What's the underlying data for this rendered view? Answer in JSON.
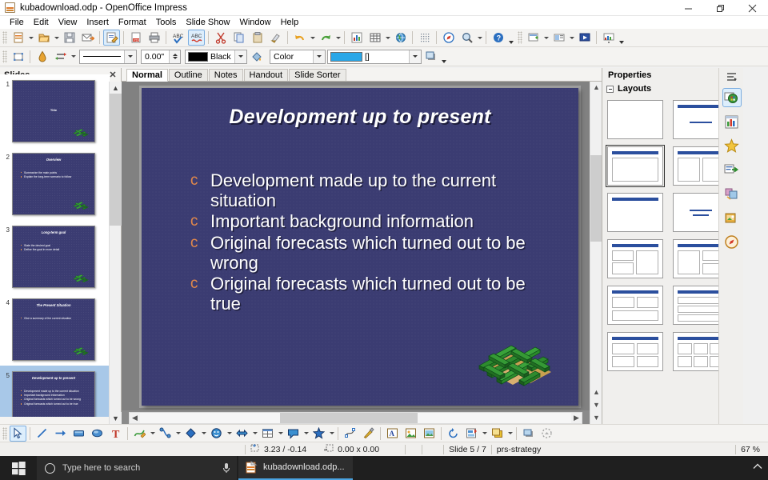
{
  "window": {
    "title": "kubadownload.odp - OpenOffice Impress",
    "icon": "impress-document-icon",
    "controls": {
      "minimize": "–",
      "restore": "❐",
      "close": "✕"
    }
  },
  "menubar": {
    "items": [
      "File",
      "Edit",
      "View",
      "Insert",
      "Format",
      "Tools",
      "Slide Show",
      "Window",
      "Help"
    ]
  },
  "toolbar_standard": {
    "items": [
      {
        "name": "new-document",
        "glyph": "new",
        "dropdown": true
      },
      {
        "name": "open-document",
        "glyph": "open",
        "dropdown": true
      },
      {
        "name": "save-document",
        "glyph": "save"
      },
      {
        "name": "email-document",
        "glyph": "email"
      },
      {
        "name": "edit-file",
        "glyph": "editfile",
        "active": true
      },
      {
        "name": "export-pdf",
        "glyph": "pdf"
      },
      {
        "name": "print-file",
        "glyph": "print"
      },
      {
        "name": "spelling",
        "glyph": "abc-check"
      },
      {
        "name": "autospellcheck",
        "glyph": "abc-red",
        "active": true
      },
      {
        "name": "cut",
        "glyph": "cut"
      },
      {
        "name": "copy",
        "glyph": "copy"
      },
      {
        "name": "paste",
        "glyph": "paste"
      },
      {
        "name": "clone-formatting",
        "glyph": "brush"
      },
      {
        "name": "undo",
        "glyph": "undo",
        "dropdown": true
      },
      {
        "name": "redo",
        "glyph": "redo",
        "dropdown": true
      },
      {
        "name": "insert-chart",
        "glyph": "chart"
      },
      {
        "name": "insert-table",
        "glyph": "table",
        "dropdown": true
      },
      {
        "name": "hyperlink",
        "glyph": "globe"
      },
      {
        "name": "display-grid",
        "glyph": "grid"
      },
      {
        "name": "navigator",
        "glyph": "compass"
      },
      {
        "name": "zoom",
        "glyph": "zoom",
        "dropdown": true
      },
      {
        "name": "help",
        "glyph": "help"
      },
      {
        "name": "master-slide",
        "glyph": "masterpage",
        "dropdown": true
      },
      {
        "name": "display-views",
        "glyph": "displayview",
        "dropdown": true
      },
      {
        "name": "start-slideshow",
        "glyph": "slideshow"
      },
      {
        "name": "slide-show-settings",
        "glyph": "showsettings"
      }
    ]
  },
  "toolbar_line_fill": {
    "line_style_value": "—————",
    "line_width_value": "0.00\"",
    "line_color_name": "Black",
    "line_color_hex": "#000000",
    "fill_style_value": "Color",
    "fill_color_name": "[]",
    "fill_color_hex": "#29a7e8",
    "buttons": [
      {
        "name": "position-and-size",
        "glyph": "possize"
      },
      {
        "name": "line-color",
        "glyph": "linecolor"
      },
      {
        "name": "arrow-style",
        "glyph": "arrowstyle",
        "dropdown": true
      },
      {
        "name": "area-style",
        "glyph": "bucket"
      },
      {
        "name": "shadow",
        "glyph": "shadow"
      }
    ]
  },
  "slides_panel": {
    "title": "Slides",
    "close_icon": "✕",
    "thumbnails": [
      {
        "number": "1",
        "title": "Title",
        "title_italic": false,
        "bullets": []
      },
      {
        "number": "2",
        "title": "Overview",
        "title_italic": true,
        "bullets": [
          "Summarize the main points",
          "Explain the long-term scenario to follow"
        ]
      },
      {
        "number": "3",
        "title": "Long-term goal",
        "title_italic": true,
        "bullets": [
          "State the desired goal",
          "Define the goal in more detail"
        ]
      },
      {
        "number": "4",
        "title": "The Present Situation",
        "title_italic": true,
        "bullets": [
          "Give a summary of the current situation"
        ]
      },
      {
        "number": "5",
        "title": "Development up to present",
        "title_italic": true,
        "selected": true,
        "bullets": [
          "Development made up to the current situation",
          "Important background information",
          "Original forecasts which turned out to be wrong",
          "Original forecasts which turned out to be true"
        ]
      }
    ]
  },
  "view_tabs": {
    "items": [
      {
        "label": "Normal",
        "active": true
      },
      {
        "label": "Outline",
        "active": false
      },
      {
        "label": "Notes",
        "active": false
      },
      {
        "label": "Handout",
        "active": false
      },
      {
        "label": "Slide Sorter",
        "active": false
      }
    ]
  },
  "slide": {
    "title": "Development up to present",
    "bullet_marker": "ɔ",
    "bullet_color": "#e2884a",
    "background_color": "#3b3c72",
    "text_color": "#ffffff",
    "bullets": [
      "Development made up to the current situation",
      "Important background information",
      "Original forecasts which turned out to be wrong",
      "Original forecasts which turned out to be true"
    ],
    "decoration": "isometric-maze-graphic"
  },
  "properties_panel": {
    "title": "Properties",
    "close_icon": "✕",
    "more_options_icon": "panel-menu-icon",
    "section_title": "Layouts",
    "layouts": [
      {
        "name": "blank-slide",
        "type": "blank",
        "selected": false
      },
      {
        "name": "title-content",
        "type": "title-subtitle",
        "selected": false
      },
      {
        "name": "title-only-content",
        "type": "title-body",
        "selected": true
      },
      {
        "name": "title-two-content",
        "type": "title-two-box",
        "selected": false
      },
      {
        "name": "title-only",
        "type": "title-empty",
        "selected": false
      },
      {
        "name": "centered-text",
        "type": "centered-lines",
        "selected": false
      },
      {
        "name": "two-content-left-split",
        "type": "title-left-split",
        "selected": false
      },
      {
        "name": "two-content-right-split",
        "type": "title-right-split",
        "selected": false
      },
      {
        "name": "two-top-one-bottom",
        "type": "title-two-top-one-bottom",
        "selected": false
      },
      {
        "name": "three-rows",
        "type": "title-three-rows",
        "selected": false
      },
      {
        "name": "four-content",
        "type": "title-four-box",
        "selected": false
      },
      {
        "name": "six-content",
        "type": "title-six-box",
        "selected": false
      }
    ],
    "tabs": [
      {
        "name": "master-pages-tab",
        "icon": "master-pages-icon",
        "selected": true
      },
      {
        "name": "character-styles-tab",
        "icon": "styles-icon",
        "selected": false
      },
      {
        "name": "gallery-tab",
        "icon": "gallery-star-icon",
        "selected": false
      },
      {
        "name": "animation-tab",
        "icon": "custom-animation-icon",
        "selected": false
      },
      {
        "name": "slide-transition-tab",
        "icon": "slide-transition-icon",
        "selected": false
      },
      {
        "name": "shapes-tab",
        "icon": "shapes-icon",
        "selected": false
      },
      {
        "name": "navigator-tab",
        "icon": "navigator-compass-icon",
        "selected": false
      }
    ]
  },
  "drawing_toolbar": {
    "items": [
      {
        "name": "select-tool",
        "glyph": "arrow",
        "active": true
      },
      {
        "name": "line-tool",
        "glyph": "line"
      },
      {
        "name": "line-ends-with-arrow",
        "glyph": "arrowline"
      },
      {
        "name": "rectangle-tool",
        "glyph": "rect"
      },
      {
        "name": "ellipse-tool",
        "glyph": "ellipse"
      },
      {
        "name": "text-tool",
        "glyph": "text"
      },
      {
        "name": "curve-tool",
        "glyph": "curve",
        "dropdown": true
      },
      {
        "name": "connector-tool",
        "glyph": "connector",
        "dropdown": true
      },
      {
        "name": "basic-shapes",
        "glyph": "diamond",
        "dropdown": true
      },
      {
        "name": "symbol-shapes",
        "glyph": "smiley",
        "dropdown": true
      },
      {
        "name": "block-arrows",
        "glyph": "blockarrow",
        "dropdown": true
      },
      {
        "name": "flowchart-shapes",
        "glyph": "flowchart",
        "dropdown": true
      },
      {
        "name": "callout-shapes",
        "glyph": "callout",
        "dropdown": true
      },
      {
        "name": "stars-shapes",
        "glyph": "star",
        "dropdown": true
      },
      {
        "name": "points-tool",
        "glyph": "points"
      },
      {
        "name": "glue-points",
        "glyph": "gluepoint"
      },
      {
        "name": "fontwork-gallery",
        "glyph": "fontwork"
      },
      {
        "name": "insert-image",
        "glyph": "image"
      },
      {
        "name": "insert-chart-draw",
        "glyph": "drawchart"
      },
      {
        "name": "rotate-tool",
        "glyph": "rotate"
      },
      {
        "name": "alignment",
        "glyph": "align",
        "dropdown": true
      },
      {
        "name": "arrange",
        "glyph": "arrange",
        "dropdown": true
      },
      {
        "name": "shadow-draw",
        "glyph": "shadowdraw"
      },
      {
        "name": "filter-draw",
        "glyph": "filter"
      }
    ]
  },
  "statusbar": {
    "cursor_position": "3.23 / -0.14",
    "object_size": "0.00 x 0.00",
    "slide_indicator": "Slide 5 / 7",
    "master_name": "prs-strategy",
    "zoom_level": "67 %"
  },
  "taskbar": {
    "start_icon": "windows-start-icon",
    "search_placeholder": "Type here to search",
    "mic_icon": "microphone-icon",
    "task_label": "kubadownload.odp...",
    "task_icon": "impress-document-icon",
    "tray_icon": "show-hidden-icons-chevron"
  }
}
